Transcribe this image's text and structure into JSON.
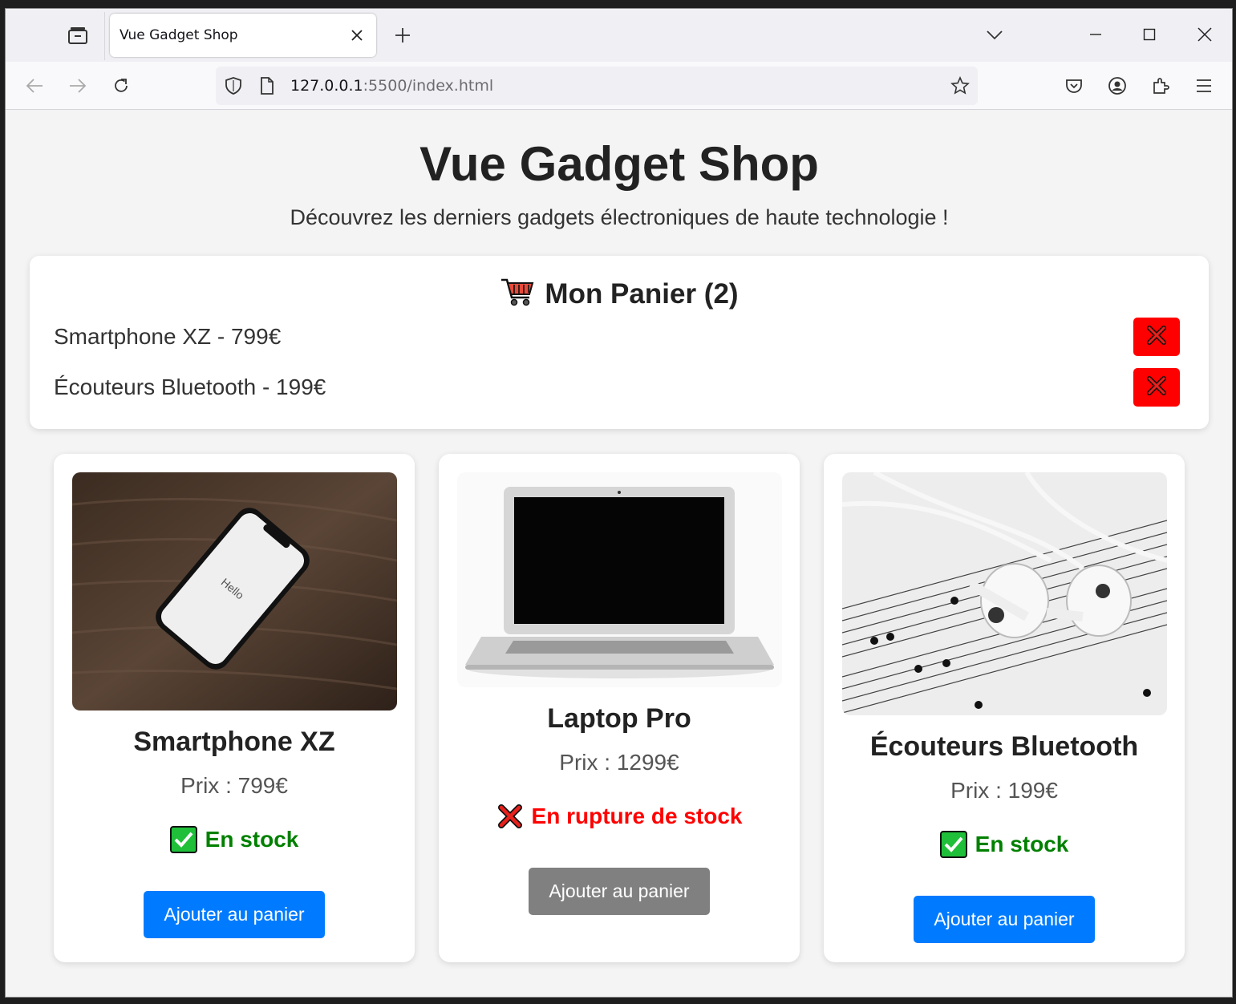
{
  "browser": {
    "tab_title": "Vue Gadget Shop",
    "url_host": "127.0.0.1",
    "url_path": ":5500/index.html"
  },
  "page": {
    "title": "Vue Gadget Shop",
    "subtitle": "Découvrez les derniers gadgets électroniques de haute technologie !"
  },
  "cart": {
    "title": "Mon Panier (2)",
    "items": [
      {
        "label": "Smartphone XZ - 799€"
      },
      {
        "label": "Écouteurs Bluetooth - 199€"
      }
    ]
  },
  "products": [
    {
      "name": "Smartphone XZ",
      "price": "Prix : 799€",
      "status": "En stock",
      "in_stock": true,
      "button": "Ajouter au panier",
      "image": "smartphone on dark wood table"
    },
    {
      "name": "Laptop Pro",
      "price": "Prix : 1299€",
      "status": "En rupture de stock",
      "in_stock": false,
      "button": "Ajouter au panier",
      "image": "silver laptop"
    },
    {
      "name": "Écouteurs Bluetooth",
      "price": "Prix : 199€",
      "status": "En stock",
      "in_stock": true,
      "button": "Ajouter au panier",
      "image": "white earphones on sheet music"
    }
  ],
  "colors": {
    "in_stock": "#008000",
    "out_of_stock": "#ff0000",
    "button_primary": "#007bff",
    "button_disabled": "#808080",
    "remove_button": "#ff0000"
  }
}
